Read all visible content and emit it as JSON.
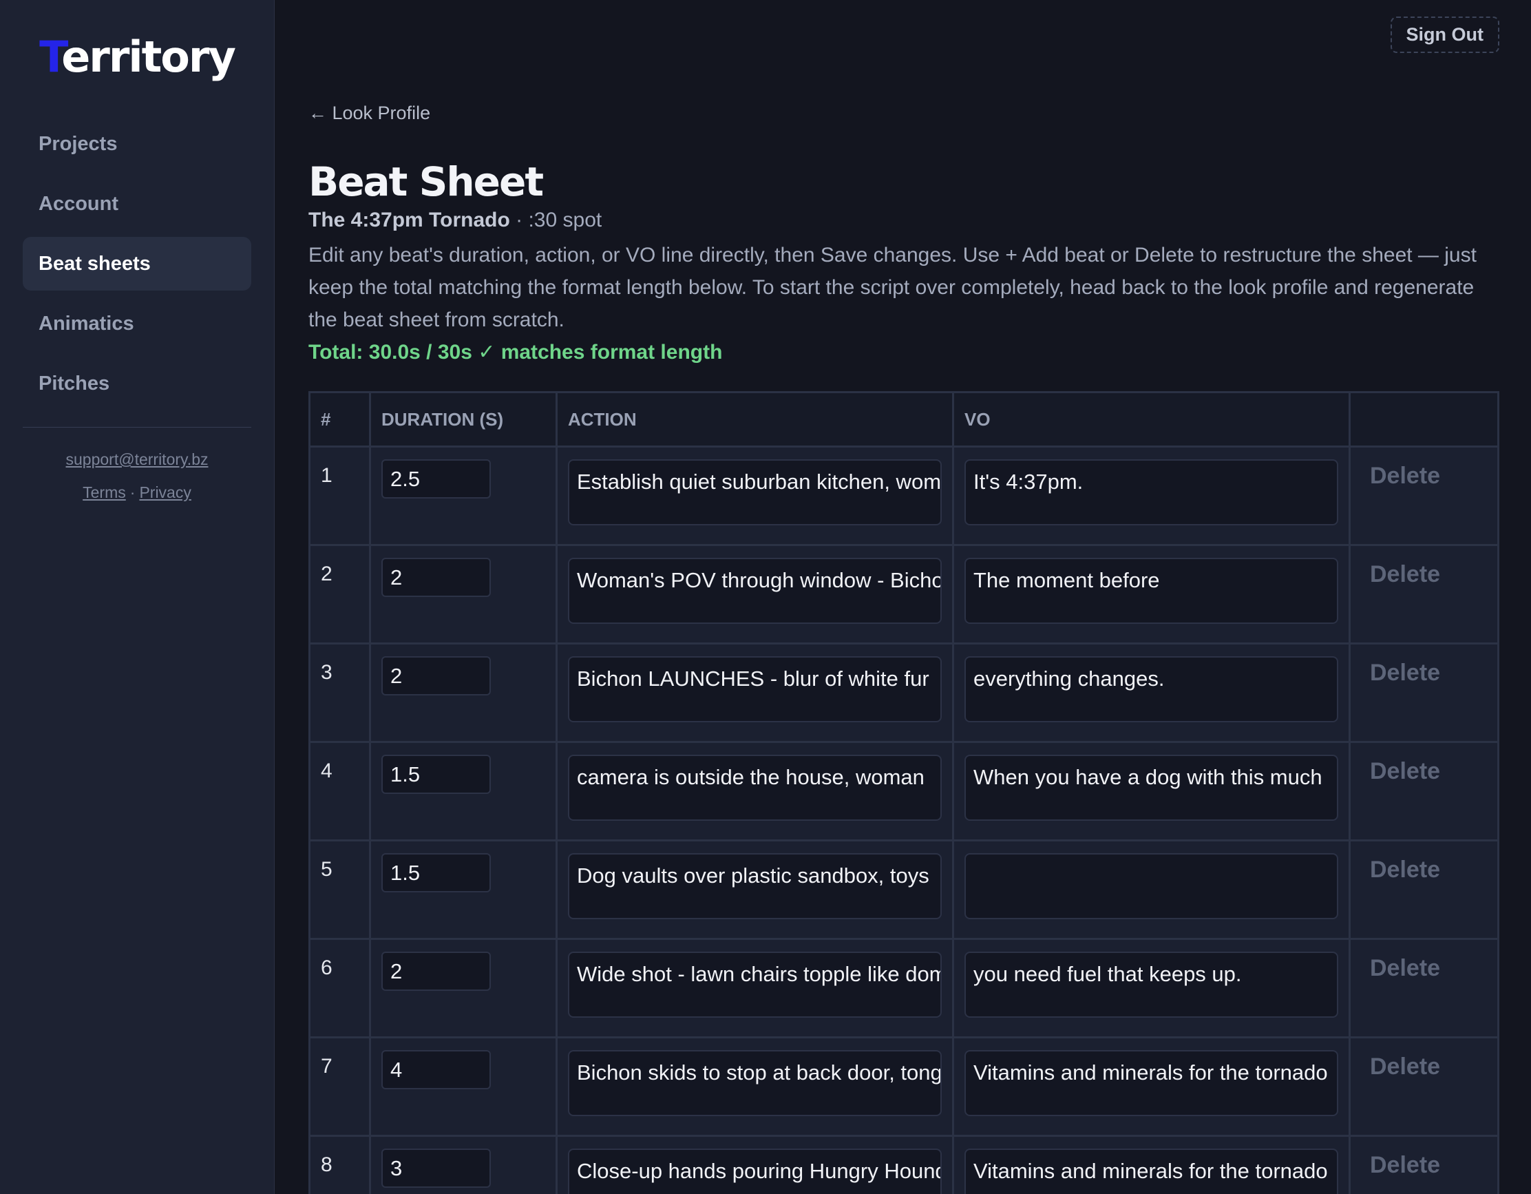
{
  "sidebar": {
    "logo_first": "T",
    "logo_rest": "erritory",
    "nav": [
      {
        "label": "Projects",
        "active": false
      },
      {
        "label": "Account",
        "active": false
      },
      {
        "label": "Beat sheets",
        "active": true
      },
      {
        "label": "Animatics",
        "active": false
      },
      {
        "label": "Pitches",
        "active": false
      }
    ],
    "support_email": "support@territory.bz",
    "terms_label": "Terms",
    "legal_separator": "·",
    "privacy_label": "Privacy"
  },
  "header": {
    "signout_label": "Sign Out",
    "back_label": "← Look Profile"
  },
  "page": {
    "title": "Beat Sheet",
    "project_name": "The 4:37pm Tornado",
    "spot_info": " · :30 spot",
    "description": "Edit any beat's duration, action, or VO line directly, then Save changes. Use + Add beat or Delete to restructure the sheet — just keep the total matching the format length below. To start the script over completely, head back to the look profile and regenerate the beat sheet from scratch.",
    "total": "Total: 30.0s / 30s ✓ matches format length"
  },
  "table": {
    "columns": [
      "#",
      "DURATION (S)",
      "ACTION",
      "VO",
      ""
    ],
    "delete_label": "Delete",
    "rows": [
      {
        "num": "1",
        "duration": "2.5",
        "action": "Establish quiet suburban kitchen, woman",
        "vo": "It's 4:37pm."
      },
      {
        "num": "2",
        "duration": "2",
        "action": "Woman's POV through window - Bichon",
        "vo": "The moment before"
      },
      {
        "num": "3",
        "duration": "2",
        "action": "Bichon LAUNCHES - blur of white fur",
        "vo": "everything changes."
      },
      {
        "num": "4",
        "duration": "1.5",
        "action": "camera is outside the house, woman",
        "vo": "When you have a dog with this much"
      },
      {
        "num": "5",
        "duration": "1.5",
        "action": "Dog vaults over plastic sandbox, toys",
        "vo": ""
      },
      {
        "num": "6",
        "duration": "2",
        "action": "Wide shot - lawn chairs topple like dominoes",
        "vo": "you need fuel that keeps up."
      },
      {
        "num": "7",
        "duration": "4",
        "action": "Bichon skids to stop at back door, tongue",
        "vo": "Vitamins and minerals for the tornado"
      },
      {
        "num": "8",
        "duration": "3",
        "action": "Close-up hands pouring Hungry Hound",
        "vo": "Vitamins and minerals for the tornado"
      }
    ]
  }
}
